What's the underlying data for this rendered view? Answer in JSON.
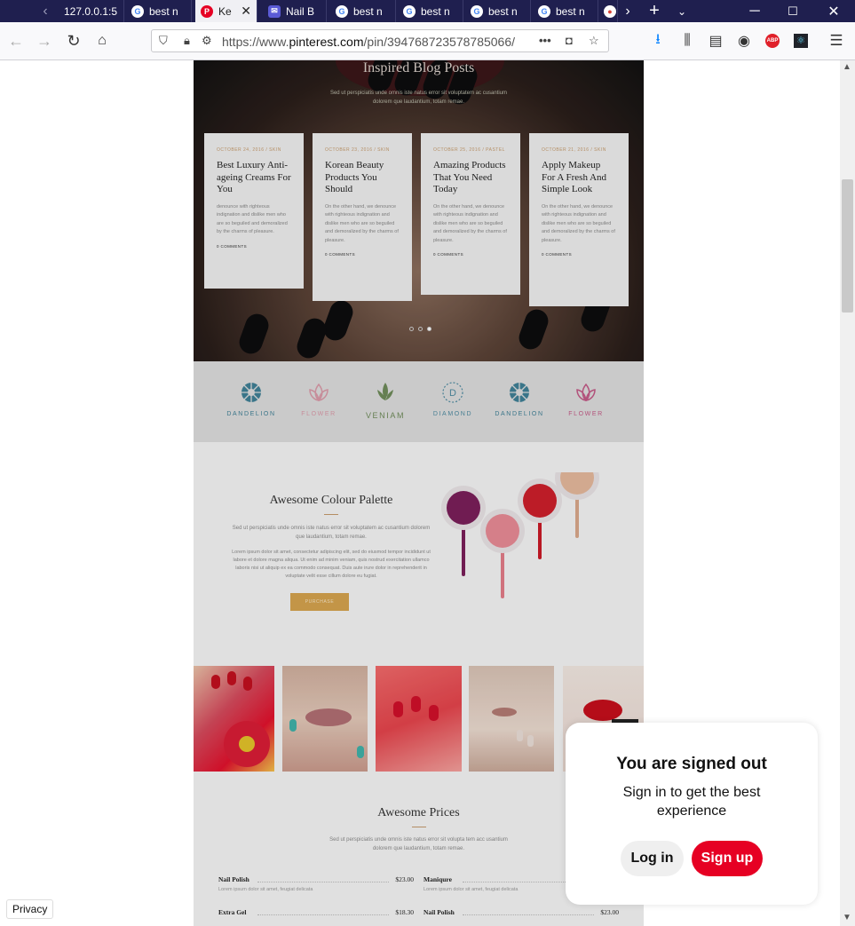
{
  "browser": {
    "tabs": [
      {
        "favicon": "back-chevron",
        "title": ""
      },
      {
        "favicon": "none",
        "title": "127.0.0.1:5"
      },
      {
        "favicon": "google-icon",
        "title": "best n"
      },
      {
        "favicon": "pinterest-icon",
        "title": "Ke",
        "active": true
      },
      {
        "favicon": "nail-icon",
        "title": "Nail B"
      },
      {
        "favicon": "google-icon",
        "title": "best n"
      },
      {
        "favicon": "google-icon",
        "title": "best n"
      },
      {
        "favicon": "google-icon",
        "title": "best n"
      },
      {
        "favicon": "google-icon",
        "title": "best n"
      }
    ],
    "url_prefix": "https://www.",
    "url_domain": "pinterest.com",
    "url_path": "/pin/394768723578785066/",
    "page_actions": "•••"
  },
  "blog": {
    "heading": "Inspired Blog Posts",
    "subheading": "Sed ut perspiciatis unde omnis iste natus error sit voluptatem ac cusantium dolorem que laudantium, totam remae.",
    "cards": [
      {
        "date": "OCTOBER 24, 2016 / SKIN",
        "title": "Best Luxury Anti-ageing Creams For You",
        "excerpt": "denounce with righteous indignation and dislike men who are so beguiled and demoralized by the charms of pleasure.",
        "comments": "0 COMMENTS"
      },
      {
        "date": "OCTOBER 23, 2016 / SKIN",
        "title": "Korean Beauty Products You Should",
        "excerpt": "On the other hand, we denounce with righteous indignation and dislike men who are so beguiled and demoralized by the charms of pleasure.",
        "comments": "0 COMMENTS"
      },
      {
        "date": "OCTOBER 25, 2016 / PASTEL",
        "title": "Amazing Products That You Need Today",
        "excerpt": "On the other hand, we denounce with righteous indignation and dislike men who are so beguiled and demoralized by the charms of pleasure.",
        "comments": "0 COMMENTS"
      },
      {
        "date": "OCTOBER 21, 2016 / SKIN",
        "title": "Apply Makeup For A Fresh And Simple Look",
        "excerpt": "On the other hand, we denounce with righteous indignation and dislike men who are so beguiled and demoralized by the charms of pleasure.",
        "comments": "0 COMMENTS"
      }
    ]
  },
  "logos": [
    {
      "name": "DANDELION",
      "color": "#3f7f95"
    },
    {
      "name": "FLOWER",
      "color": "#d89aa8"
    },
    {
      "name": "VENIAM",
      "color": "#6e8a5a"
    },
    {
      "name": "DIAMOND",
      "color": "#4f8aa0"
    },
    {
      "name": "DANDELION",
      "color": "#3f7f95"
    },
    {
      "name": "FLOWER",
      "color": "#c25a86"
    }
  ],
  "palette": {
    "heading": "Awesome Colour Palette",
    "intro": "Sed ut perspiciatis unde omnis iste natus error sit voluptatem ac cusantium dolorem que laudantium, totam remae.",
    "body": "Lorem ipsum dolor sit amet, consectetur adipiscing elit, sed do eiusmod tempor incididunt ut labore et dolore magna aliqua. Ut enim ad minim veniam, quis nostrud exercitation ullamco laboris nisi ut aliquip ex ea commodo consequat. Duis aute irure dolor in reprehenderit in voluptate velit esse cillum dolore eu fugiat.",
    "button": "PURCHASE"
  },
  "prices": {
    "heading": "Awesome Prices",
    "subheading": "Sed ut perspiciatis unde omnis iste natus error sit volupta tem acc usantium dolorem que laudantium, totam remae.",
    "items": [
      {
        "name": "Nail Polish",
        "price": "$23.00",
        "desc": "Lorem ipsum dolor sit amet, feugiat delicata"
      },
      {
        "name": "Maniqure",
        "price": "",
        "desc": "Lorem ipsum dolor sit amet, feugiat delicata"
      },
      {
        "name": "Extra Gel",
        "price": "$18.30",
        "desc": ""
      },
      {
        "name": "Nail Polish",
        "price": "$23.00",
        "desc": ""
      }
    ]
  },
  "signed_out": {
    "title": "You are signed out",
    "message": "Sign in to get the best experience",
    "login": "Log in",
    "signup": "Sign up",
    "signup_color": "#e60023"
  },
  "footer": {
    "privacy": "Privacy"
  }
}
